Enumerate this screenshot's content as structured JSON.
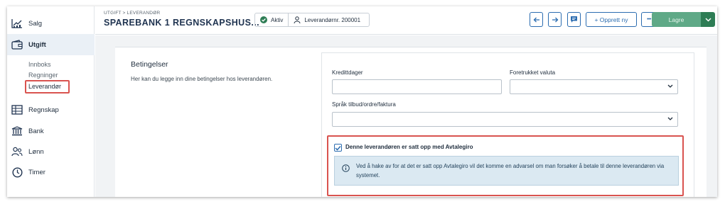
{
  "sidebar": {
    "items": [
      {
        "label": "Salg",
        "icon": "chart-icon"
      },
      {
        "label": "Utgift",
        "icon": "wallet-icon"
      },
      {
        "label": "Regnskap",
        "icon": "ledger-icon"
      },
      {
        "label": "Bank",
        "icon": "bank-icon"
      },
      {
        "label": "Lønn",
        "icon": "people-icon"
      },
      {
        "label": "Timer",
        "icon": "clock-icon"
      }
    ],
    "sub_items": [
      {
        "label": "Innboks"
      },
      {
        "label": "Regninger"
      },
      {
        "label": "Leverandør"
      }
    ]
  },
  "header": {
    "breadcrumb": "UTGIFT > LEVERANDØR",
    "title": "SPAREBANK 1 REGNSKAPSHUS...",
    "status_label": "Aktiv",
    "supplier_no": "Leverandørnr. 200001",
    "new_label": "+ Opprett ny",
    "more_label": "•••",
    "save_label": "Lagre"
  },
  "section": {
    "title": "Betingelser",
    "description": "Her kan du legge inn dine betingelser hos leverandøren."
  },
  "form": {
    "credit_days_label": "Kredittdager",
    "credit_days_value": "",
    "currency_label": "Foretrukket valuta",
    "currency_value": "",
    "language_label": "Språk tilbud/ordre/faktura",
    "language_value": "",
    "avtalegiro_label": "Denne leverandøren er satt opp med Avtalegiro",
    "avtalegiro_checked": true,
    "info_text": "Ved å hake av for at det er satt opp Avtalegiro vil det komme en advarsel om man forsøker å betale til denne leverandøren via systemet."
  },
  "colors": {
    "accent": "#2b6cb0",
    "save": "#5fa987",
    "save_dark": "#2e7d55",
    "highlight": "#d9534f",
    "info_bg": "#dbe9f2"
  }
}
